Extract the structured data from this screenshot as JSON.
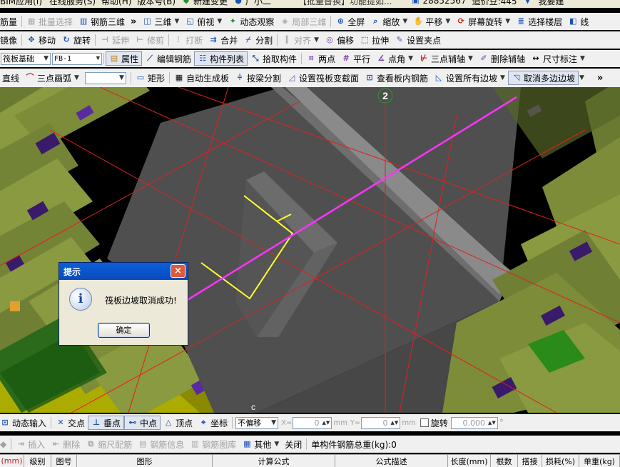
{
  "menubar": {
    "items": [
      "BIM应用(I)",
      "在线服务(S)",
      "帮助(H)",
      "版本号(B)",
      "新建变更",
      "广小二",
      "【批量替换】功能提如...",
      "28852567",
      "造价豆:445",
      "我要建"
    ]
  },
  "toolbar1": {
    "items": [
      "筋量",
      "批量选择",
      "钢筋三维",
      "三维",
      "俯视",
      "动态观察",
      "局部三维",
      "全屏",
      "缩放",
      "平移",
      "屏幕旋转",
      "选择楼层",
      "线"
    ]
  },
  "toolbar2": {
    "items": [
      "镜像",
      "移动",
      "旋转",
      "延伸",
      "修剪",
      "打断",
      "合并",
      "分割",
      "对齐",
      "偏移",
      "拉伸",
      "设置夹点"
    ]
  },
  "toolbar3": {
    "component_type": "筏板基础",
    "component_name": "FB-1",
    "items": [
      "属性",
      "编辑钢筋",
      "构件列表",
      "拾取构件",
      "两点",
      "平行",
      "点角",
      "三点辅轴",
      "删除辅轴",
      "尺寸标注"
    ]
  },
  "toolbar4": {
    "items": [
      "直线",
      "三点画弧",
      "矩形",
      "自动生成板",
      "按梁分割",
      "设置筏板变截面",
      "查看板内钢筋",
      "设置所有边坡",
      "取消多边边坡"
    ],
    "overflow": "»"
  },
  "viewport": {
    "axis_label": "2",
    "colors": {
      "bg": "#000000",
      "slab": "#5b5b5b",
      "edge": "#808080",
      "arrow": "#ff33ff",
      "grid": "#e02020",
      "rebar": "#ffff30"
    }
  },
  "dialog": {
    "title": "提示",
    "message": "筏板边坡取消成功!",
    "ok_label": "确定",
    "close": "×"
  },
  "snapbar": {
    "items": [
      "动态输入",
      "交点",
      "垂点",
      "中点",
      "顶点",
      "坐标"
    ],
    "offset_mode": "不偏移",
    "x_label": "X=",
    "x_value": "0",
    "x_unit": "mm",
    "y_label": "Y=",
    "y_value": "0",
    "y_unit": "mm",
    "rotate_label": "旋转",
    "rotate_value": "0.000",
    "rotate_unit": "°"
  },
  "rebarbar": {
    "items": [
      "插入",
      "删除",
      "缩尺配筋",
      "钢筋信息",
      "钢筋图库",
      "其他",
      "关闭"
    ],
    "total_weight": "单构件钢筋总重(kg):0"
  },
  "table": {
    "headers": [
      "(mm)",
      "级别",
      "图号",
      "图形",
      "计算公式",
      "公式描述",
      "长度(mm)",
      "根数",
      "搭接",
      "损耗(%)",
      "单重(kg)"
    ]
  }
}
